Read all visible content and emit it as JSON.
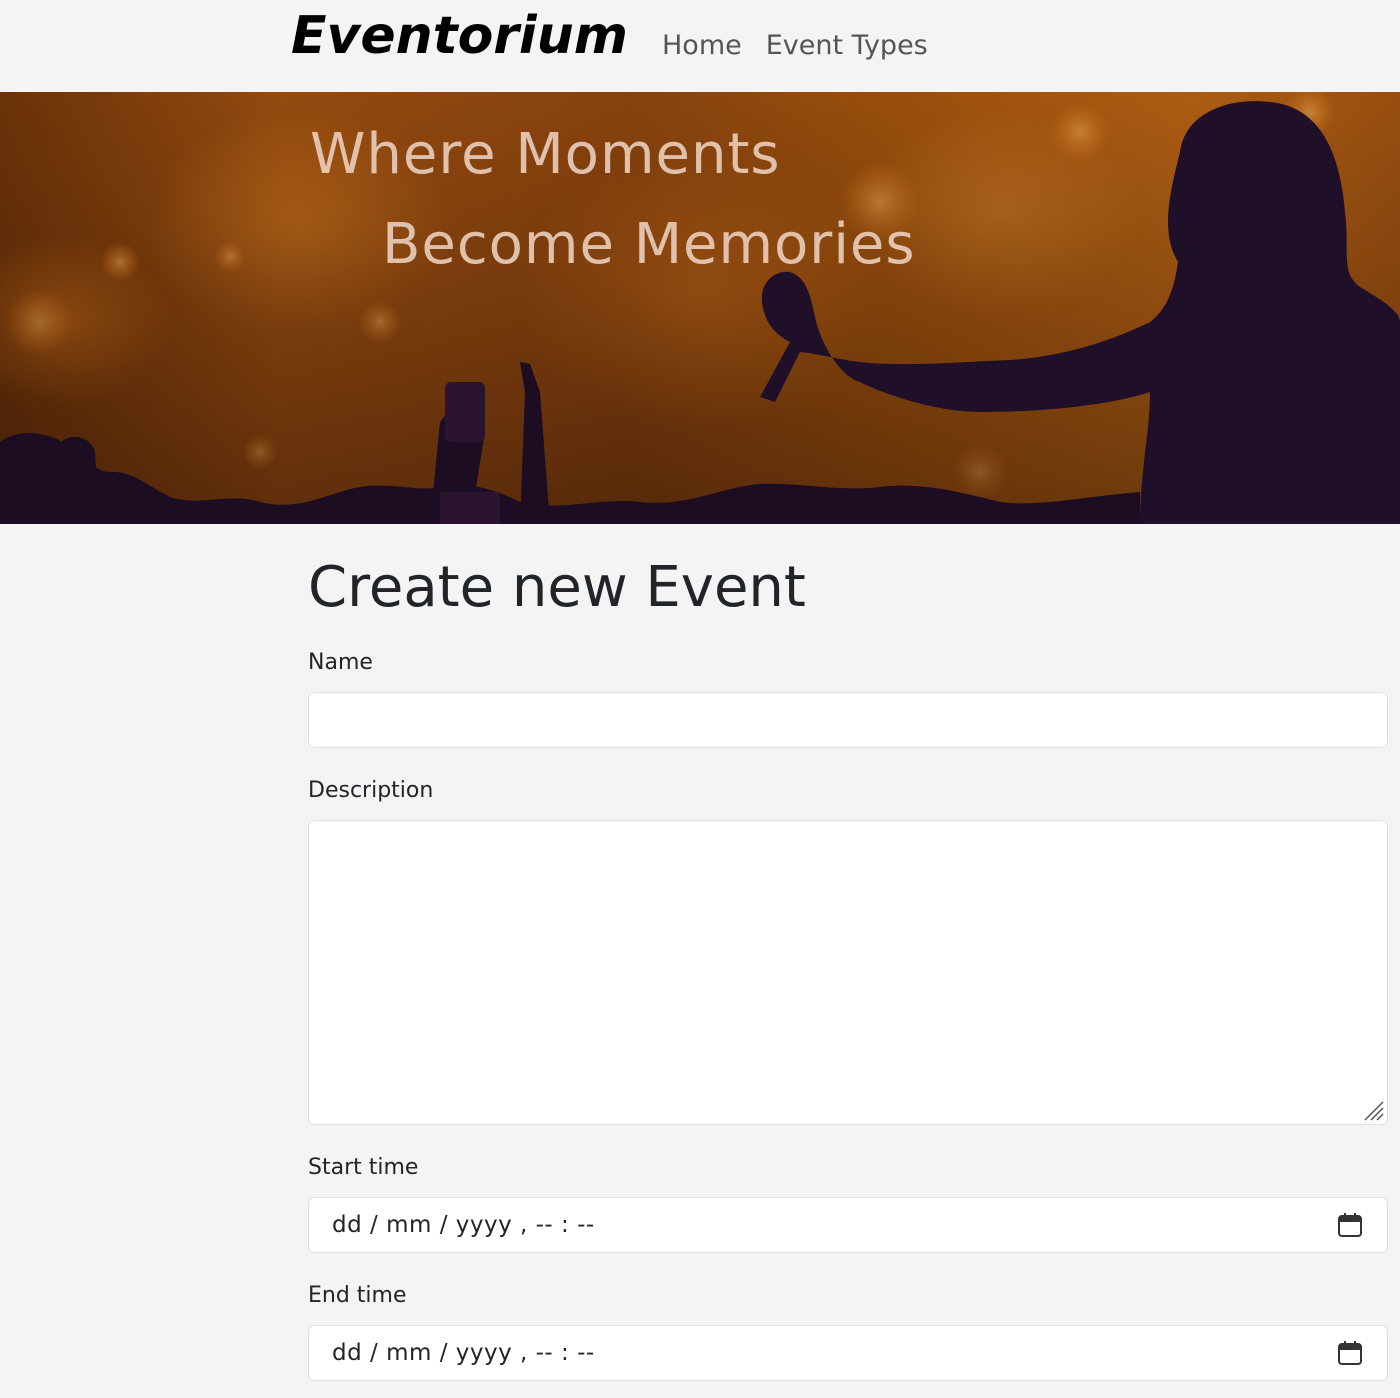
{
  "navbar": {
    "brand": "Eventorium",
    "links": [
      {
        "label": "Home"
      },
      {
        "label": "Event Types"
      }
    ]
  },
  "hero": {
    "tagline_line1": "Where Moments",
    "tagline_line2": "Become Memories"
  },
  "form": {
    "title": "Create new Event",
    "fields": {
      "name": {
        "label": "Name",
        "value": ""
      },
      "description": {
        "label": "Description",
        "value": ""
      },
      "start_time": {
        "label": "Start time",
        "placeholder": "dd / mm / yyyy ,  -- : --"
      },
      "end_time": {
        "label": "End time",
        "placeholder": "dd / mm / yyyy ,  -- : --"
      }
    }
  },
  "icons": {
    "calendar": "calendar-icon",
    "resize": "resize-grip-icon"
  }
}
